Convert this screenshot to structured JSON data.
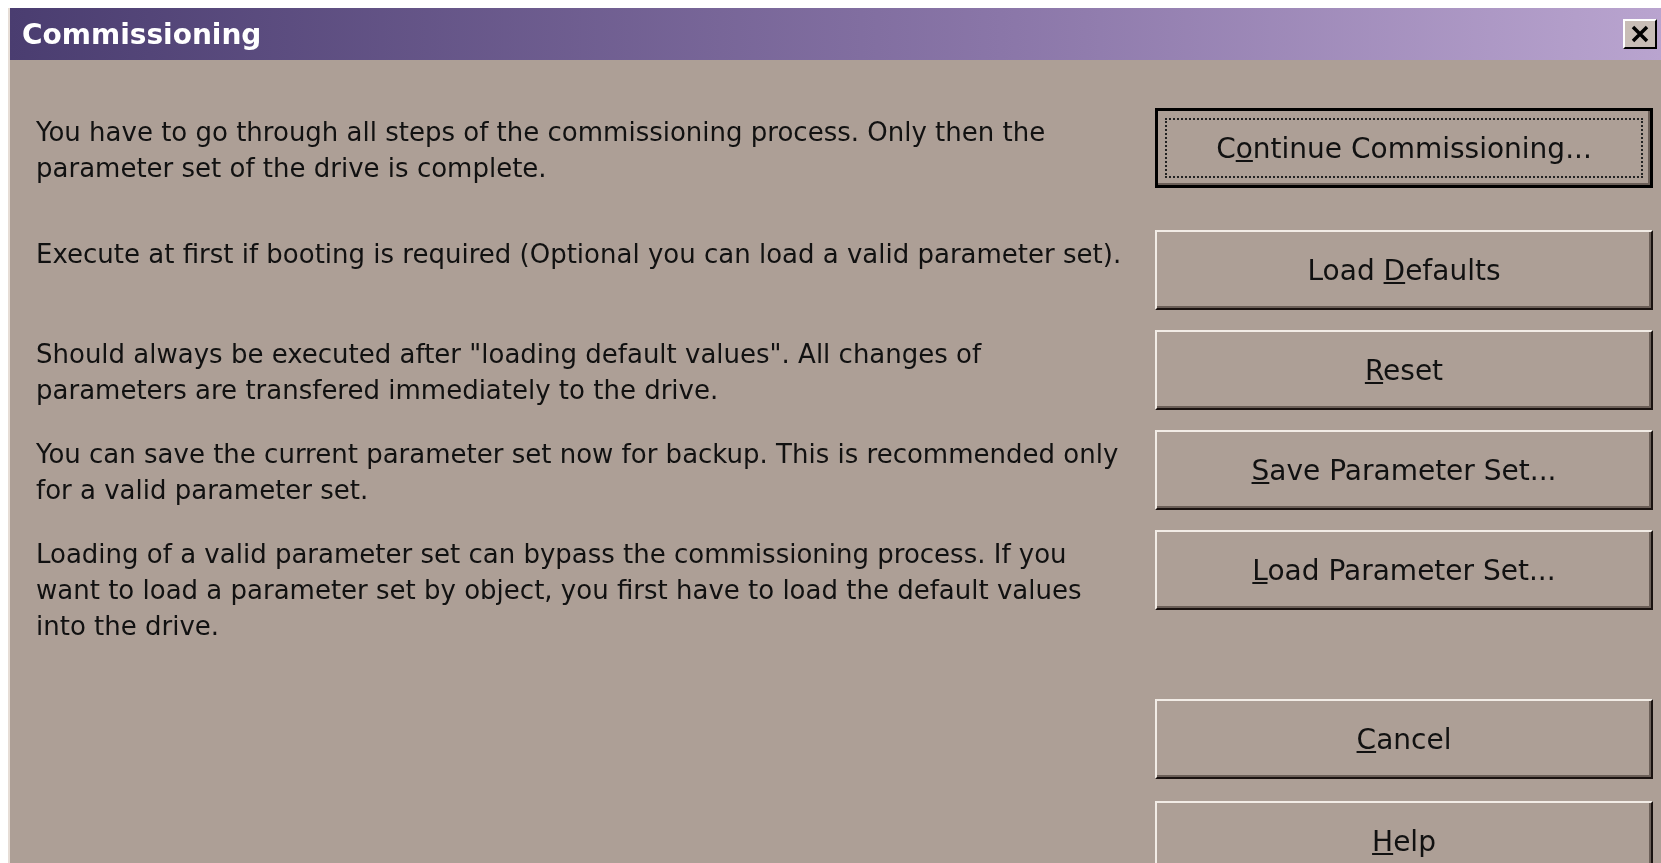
{
  "window": {
    "title": "Commissioning"
  },
  "steps": [
    {
      "description": "You have to go through all steps of the commissioning process. Only then the parameter set of the drive is complete.",
      "button": {
        "pre": "C",
        "key": "o",
        "post": "ntinue Commissioning...",
        "default": true
      }
    },
    {
      "description": "Execute at first if booting is required (Optional you can load a valid parameter set).",
      "button": {
        "pre": "Load ",
        "key": "D",
        "post": "efaults",
        "default": false
      }
    },
    {
      "description": "Should always be executed after \"loading default values\". All changes of parameters are transfered immediately to the drive.",
      "button": {
        "key": "R",
        "post": "eset",
        "default": false
      }
    },
    {
      "description": "You can save the current parameter set now for backup. This is recommended only for a valid parameter set.",
      "button": {
        "key": "S",
        "post": "ave Parameter Set...",
        "default": false
      }
    },
    {
      "description": "Loading of a valid parameter set can bypass the commissioning process. If you want to load a parameter set by object, you first have to load the default values into the drive.",
      "button": {
        "key": "L",
        "post": "oad Parameter Set...",
        "default": false
      }
    }
  ],
  "buttons": [
    {
      "key": "C",
      "post": "ancel",
      "default": false
    },
    {
      "key": "H",
      "post": "elp",
      "default": false
    }
  ]
}
